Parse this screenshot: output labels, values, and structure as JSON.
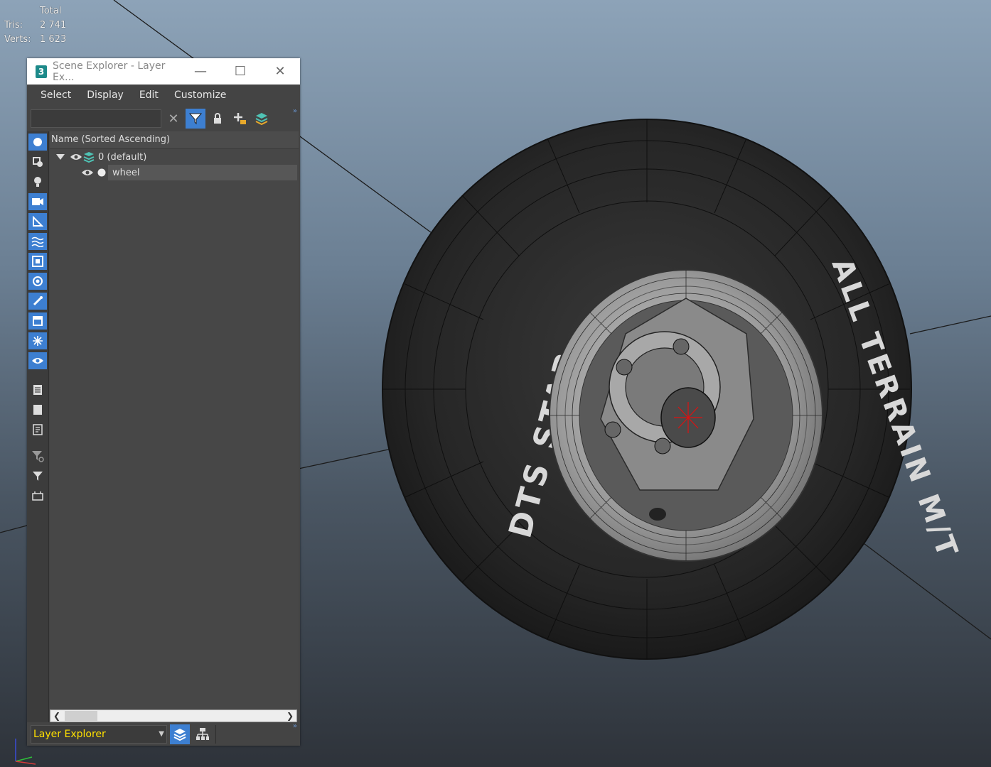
{
  "stats": {
    "header": "Total",
    "rows": [
      {
        "label": "Tris:",
        "value": "2 741"
      },
      {
        "label": "Verts:",
        "value": "1 623"
      }
    ]
  },
  "viewport": {
    "tire_text": [
      "DTS STAR",
      "ALL TERRAIN M/T"
    ]
  },
  "window": {
    "app_icon": "3",
    "title": "Scene Explorer - Layer Ex...",
    "minimize": "—",
    "maximize": "☐",
    "close": "✕"
  },
  "menu": [
    "Select",
    "Display",
    "Edit",
    "Customize"
  ],
  "toolbar": {
    "search_value": "",
    "clear_icon": "✕",
    "more": "»"
  },
  "tree": {
    "column_header": "Name (Sorted Ascending)",
    "rows": [
      {
        "label": "0 (default)"
      },
      {
        "label": "wheel"
      }
    ]
  },
  "bottom": {
    "explorer_value": "Layer Explorer",
    "more": "»"
  },
  "colors": {
    "accent": "#3d7fd1",
    "panel": "#444444",
    "highlight_text": "#ffe000"
  }
}
